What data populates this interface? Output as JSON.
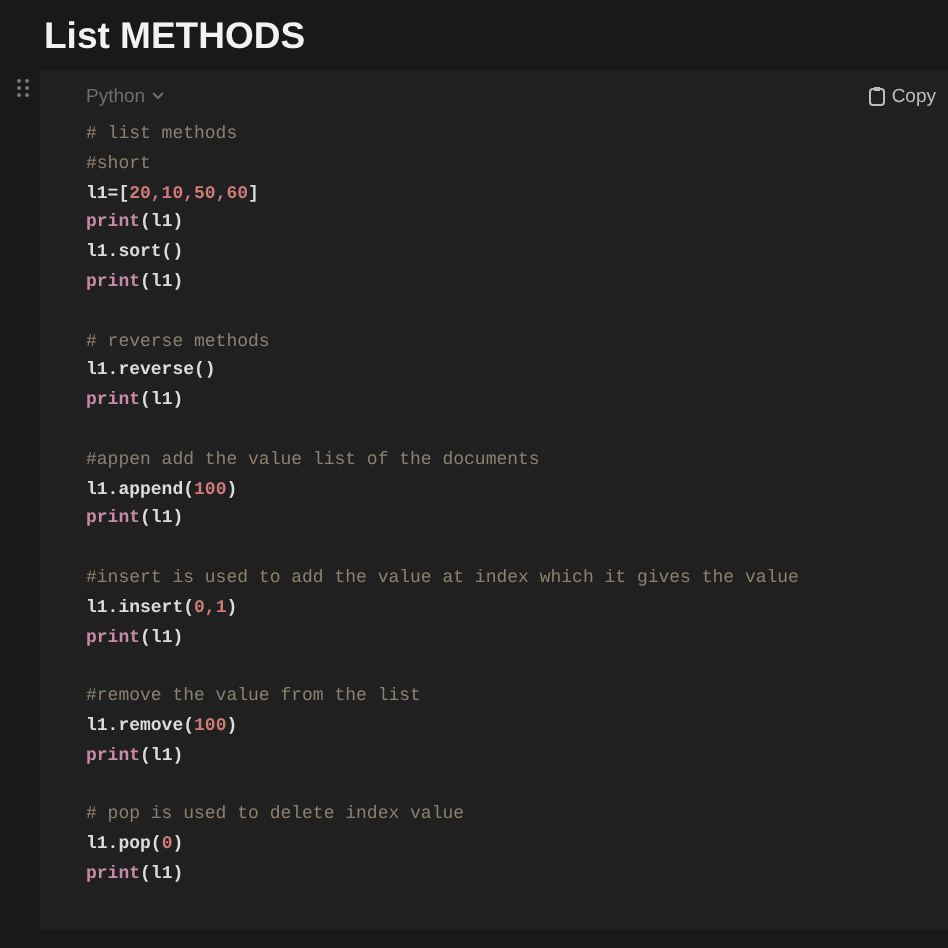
{
  "page_title": "List METHODS",
  "code_block": {
    "language": "Python",
    "copy_label": "Copy",
    "blocks": [
      {
        "lines": [
          [
            {
              "kind": "comment",
              "text": "# list methods"
            }
          ],
          [
            {
              "kind": "comment",
              "text": "#short"
            }
          ],
          [
            {
              "kind": "code",
              "text": "l1=["
            },
            {
              "kind": "number",
              "text": "20,10,50,60"
            },
            {
              "kind": "code",
              "text": "]"
            }
          ],
          [
            {
              "kind": "call",
              "text": "print"
            },
            {
              "kind": "code",
              "text": "(l1)"
            }
          ],
          [
            {
              "kind": "code",
              "text": "l1.sort()"
            }
          ],
          [
            {
              "kind": "call",
              "text": "print"
            },
            {
              "kind": "code",
              "text": "(l1)"
            }
          ]
        ]
      },
      {
        "lines": [
          [
            {
              "kind": "comment",
              "text": "# reverse methods"
            }
          ],
          [
            {
              "kind": "code",
              "text": "l1.reverse()"
            }
          ],
          [
            {
              "kind": "call",
              "text": "print"
            },
            {
              "kind": "code",
              "text": "(l1)"
            }
          ]
        ]
      },
      {
        "lines": [
          [
            {
              "kind": "comment",
              "text": "#appen add the value list of the documents"
            }
          ],
          [
            {
              "kind": "code",
              "text": "l1.append("
            },
            {
              "kind": "number",
              "text": "100"
            },
            {
              "kind": "code",
              "text": ")"
            }
          ],
          [
            {
              "kind": "call",
              "text": "print"
            },
            {
              "kind": "code",
              "text": "(l1)"
            }
          ]
        ]
      },
      {
        "lines": [
          [
            {
              "kind": "comment",
              "text": "#insert is used to add the value at index which it gives the value"
            }
          ],
          [
            {
              "kind": "code",
              "text": "l1.insert("
            },
            {
              "kind": "number",
              "text": "0,1"
            },
            {
              "kind": "code",
              "text": ")"
            }
          ],
          [
            {
              "kind": "call",
              "text": "print"
            },
            {
              "kind": "code",
              "text": "(l1)"
            }
          ]
        ]
      },
      {
        "lines": [
          [
            {
              "kind": "comment",
              "text": "#remove the value from the list"
            }
          ],
          [
            {
              "kind": "code",
              "text": "l1.remove("
            },
            {
              "kind": "number",
              "text": "100"
            },
            {
              "kind": "code",
              "text": ")"
            }
          ],
          [
            {
              "kind": "call",
              "text": "print"
            },
            {
              "kind": "code",
              "text": "(l1)"
            }
          ]
        ]
      },
      {
        "lines": [
          [
            {
              "kind": "comment",
              "text": "# pop is used to delete index value"
            }
          ],
          [
            {
              "kind": "code",
              "text": "l1.pop("
            },
            {
              "kind": "number",
              "text": "0"
            },
            {
              "kind": "code",
              "text": ")"
            }
          ],
          [
            {
              "kind": "call",
              "text": "print"
            },
            {
              "kind": "code",
              "text": "(l1)"
            }
          ]
        ]
      }
    ]
  }
}
